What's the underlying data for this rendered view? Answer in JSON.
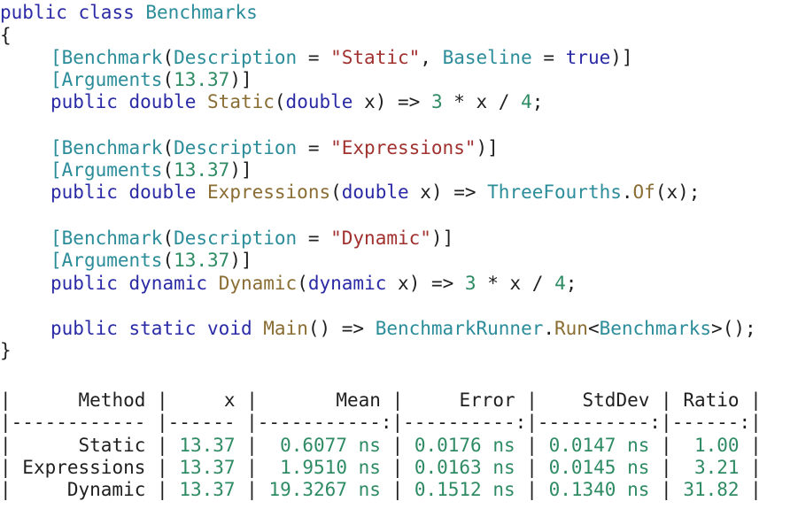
{
  "code": {
    "class_decl": {
      "kw1": "public",
      "kw2": "class",
      "name": "Benchmarks"
    },
    "open_brace": "{",
    "close_brace": "}",
    "methods": [
      {
        "attr_name": "Benchmark",
        "desc_key": "Description",
        "eq": " = ",
        "desc_val": "\"Static\"",
        "extra": ", Baseline = ",
        "extra_val": "true",
        "args_attr": "Arguments",
        "args_val": "13.37",
        "mods": "public",
        "ret": "double",
        "name": "Static",
        "param_type": "double",
        "param": "x",
        "body": [
          {
            "t": "num",
            "v": "3"
          },
          {
            "t": "pun",
            "v": " * x / "
          },
          {
            "t": "num",
            "v": "4"
          },
          {
            "t": "pun",
            "v": ";"
          }
        ]
      },
      {
        "attr_name": "Benchmark",
        "desc_key": "Description",
        "eq": " = ",
        "desc_val": "\"Expressions\"",
        "args_attr": "Arguments",
        "args_val": "13.37",
        "mods": "public",
        "ret": "double",
        "name": "Expressions",
        "param_type": "double",
        "param": "x",
        "body_ty": "ThreeFourths",
        "body_fn": "Of",
        "body_tail": "(x);"
      },
      {
        "attr_name": "Benchmark",
        "desc_key": "Description",
        "eq": " = ",
        "desc_val": "\"Dynamic\"",
        "args_attr": "Arguments",
        "args_val": "13.37",
        "mods": "public",
        "ret": "dynamic",
        "name": "Dynamic",
        "param_type": "dynamic",
        "param": "x",
        "body": [
          {
            "t": "num",
            "v": "3"
          },
          {
            "t": "pun",
            "v": " * x / "
          },
          {
            "t": "num",
            "v": "4"
          },
          {
            "t": "pun",
            "v": ";"
          }
        ]
      }
    ],
    "main": {
      "kw1": "public",
      "kw2": "static",
      "kw3": "void",
      "name": "Main",
      "runner": "BenchmarkRunner",
      "run": "Run",
      "generic": "Benchmarks"
    }
  },
  "results": {
    "headers": [
      "Method",
      "x",
      "Mean",
      "Error",
      "StdDev",
      "Ratio"
    ],
    "separator": "|------------ |------ |-----------:|----------:|----------:|------:|",
    "rows": [
      {
        "method": "Static",
        "x": "13.37",
        "mean": "0.6077 ns",
        "error": "0.0176 ns",
        "stddev": "0.0147 ns",
        "ratio": "1.00"
      },
      {
        "method": "Expressions",
        "x": "13.37",
        "mean": "1.9510 ns",
        "error": "0.0163 ns",
        "stddev": "0.0145 ns",
        "ratio": "3.21"
      },
      {
        "method": "Dynamic",
        "x": "13.37",
        "mean": "19.3267 ns",
        "error": "0.1512 ns",
        "stddev": "0.1340 ns",
        "ratio": "31.82"
      }
    ]
  }
}
